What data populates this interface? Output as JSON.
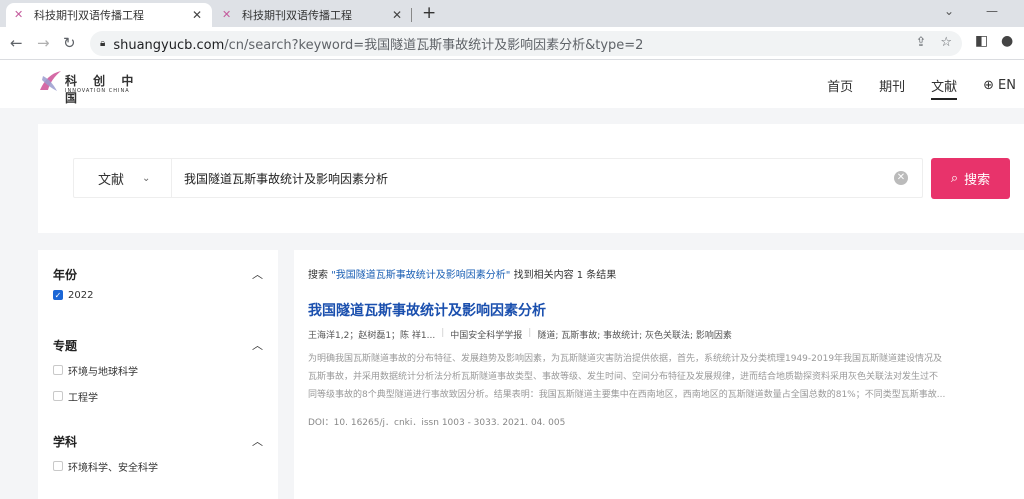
{
  "browser": {
    "tabs": [
      {
        "title": "科技期刊双语传播工程",
        "active": true
      },
      {
        "title": "科技期刊双语传播工程",
        "active": false
      }
    ],
    "url_host": "shuangyucb.com",
    "url_path": "/cn/search?keyword=我国隧道瓦斯事故统计及影响因素分析&type=2"
  },
  "site": {
    "logo_cn": "科 创 中 国",
    "logo_en": "INNOVATION CHINA",
    "nav": [
      {
        "label": "首页",
        "active": false
      },
      {
        "label": "期刊",
        "active": false
      },
      {
        "label": "文献",
        "active": true
      }
    ],
    "lang_label": "EN"
  },
  "search": {
    "scope": "文献",
    "query": "我国隧道瓦斯事故统计及影响因素分析",
    "button_label": "搜索"
  },
  "filters": [
    {
      "title": "年份",
      "options": [
        {
          "label": "2022",
          "checked": true
        }
      ]
    },
    {
      "title": "专题",
      "options": [
        {
          "label": "环境与地球科学",
          "checked": false
        },
        {
          "label": "工程学",
          "checked": false
        }
      ]
    },
    {
      "title": "学科",
      "options": [
        {
          "label": "环境科学、安全科学",
          "checked": false
        }
      ]
    }
  ],
  "results": {
    "summary_prefix": "搜索 ",
    "summary_keyword": "\"我国隧道瓦斯事故统计及影响因素分析\"",
    "summary_suffix": " 找到相关内容 1 条结果",
    "items": [
      {
        "title": "我国隧道瓦斯事故统计及影响因素分析",
        "authors": "王海洋1,2；赵树磊1；陈 祥1...",
        "journal": "中国安全科学学报",
        "keywords": "隧道; 瓦斯事故; 事故统计; 灰色关联法; 影响因素",
        "abstract_lines": [
          "为明确我国瓦斯隧道事故的分布特征、发展趋势及影响因素，为瓦斯隧道灾害防治提供依据，首先，系统统计及分类梳理1949-2019年我国瓦斯隧道建设情况及",
          "瓦斯事故，并采用数据统计分析法分析瓦斯隧道事故类型、事故等级、发生时间、空间分布特征及发展规律，进而结合地质勘探资料采用灰色关联法对发生过不",
          "同等级事故的8个典型隧道进行事故致因分析。结果表明：我国瓦斯隧道主要集中在西南地区，西南地区的瓦斯隧道数量占全国总数的81%；不同类型瓦斯事故..."
        ],
        "doi": "DOI：10. 16265/j．cnki．issn 1003 - 3033. 2021. 04. 005"
      }
    ]
  }
}
